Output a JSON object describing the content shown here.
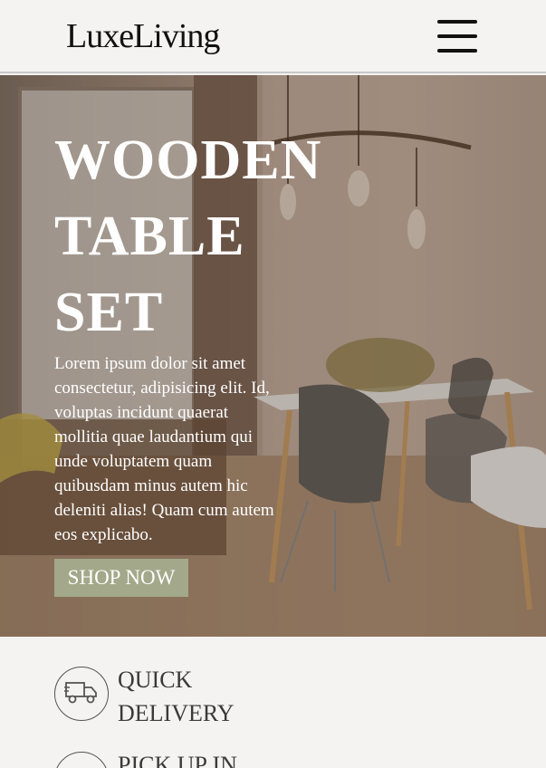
{
  "header": {
    "logo": "LuxeLiving",
    "menu_icon": "hamburger-menu-icon"
  },
  "hero": {
    "title": "WOODEN TABLE SET",
    "description": "Lorem ipsum dolor sit amet consectetur, adipisicing elit. Id, voluptas incidunt quaerat mollitia quae laudantium qui unde voluptatem quam quibusdam minus autem hic deleniti alias! Quam cum autem eos explicabo.",
    "cta_label": "SHOP NOW",
    "cta_color": "#a3a88a"
  },
  "features": [
    {
      "icon": "delivery-truck-icon",
      "label": "QUICK DELIVERY"
    },
    {
      "icon": "store-pickup-icon",
      "label": "PICK UP IN"
    }
  ]
}
